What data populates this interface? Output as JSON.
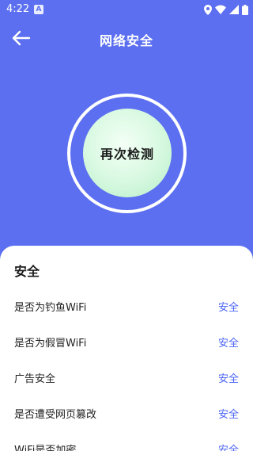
{
  "status_bar": {
    "time": "4:22",
    "badge": "A",
    "icons": [
      "location-icon",
      "wifi-icon",
      "signal-icon",
      "battery-icon"
    ]
  },
  "header": {
    "title": "网络安全",
    "back_icon": "arrow-left-icon"
  },
  "scan": {
    "button_label": "再次检测"
  },
  "results": {
    "title": "安全",
    "items": [
      {
        "label": "是否为钓鱼WiFi",
        "status": "安全"
      },
      {
        "label": "是否为假冒WiFi",
        "status": "安全"
      },
      {
        "label": "广告安全",
        "status": "安全"
      },
      {
        "label": "是否遭受网页篡改",
        "status": "安全"
      },
      {
        "label": "WiFi是否加密",
        "status": "安全"
      }
    ]
  },
  "colors": {
    "background": "#5b6ff0",
    "accent": "#4a63f5",
    "button_fill": "#d9f9e2"
  }
}
